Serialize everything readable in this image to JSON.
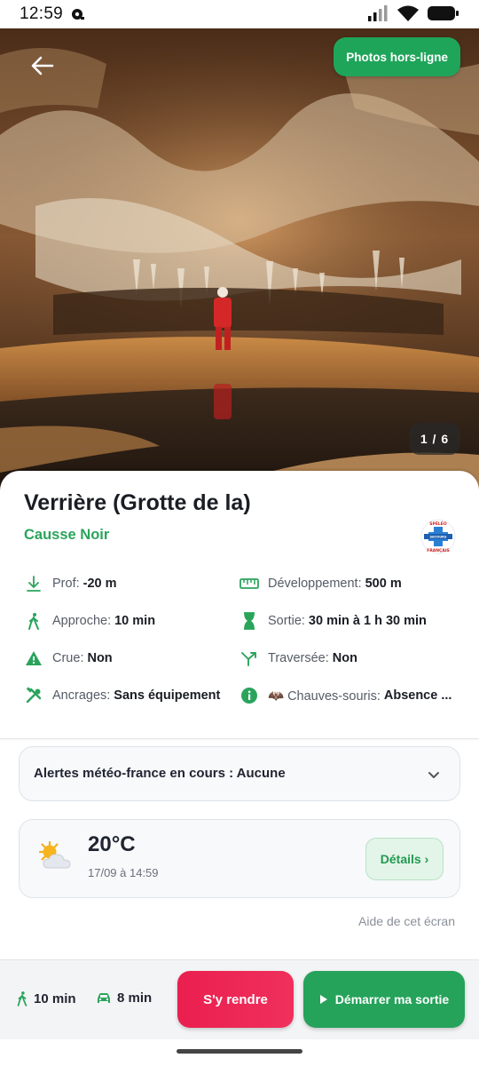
{
  "status_bar": {
    "time": "12:59",
    "icons": [
      "notification-icon",
      "signal-icon",
      "wifi-icon",
      "battery-icon"
    ]
  },
  "hero": {
    "offline_photos_label": "Photos hors-ligne",
    "photo_counter": "1 / 6",
    "icons": [
      "back-arrow-icon"
    ]
  },
  "cave": {
    "title": "Verrière (Grotte de la)",
    "region": "Causse Noir",
    "logo": {
      "name": "speleo-secours-francais-logo",
      "text": [
        "SPÉLÉO",
        "SECOURS",
        "FRANÇAIS"
      ]
    },
    "attributes": [
      {
        "id": "prof",
        "label": "Prof",
        "value": "-20 m",
        "icon": "depth-arrow-icon"
      },
      {
        "id": "developpement",
        "label": "Développement",
        "value": "500 m",
        "icon": "ruler-icon"
      },
      {
        "id": "approche",
        "label": "Approche",
        "value": "10 min",
        "icon": "walking-icon"
      },
      {
        "id": "sortie",
        "label": "Sortie",
        "value": "30 min à 1 h 30 min",
        "icon": "hourglass-icon"
      },
      {
        "id": "crue",
        "label": "Crue",
        "value": "Non",
        "icon": "warning-triangle-icon"
      },
      {
        "id": "traversee",
        "label": "Traversée",
        "value": "Non",
        "icon": "split-arrow-icon"
      },
      {
        "id": "ancrages",
        "label": "Ancrages",
        "value": "Sans équipement",
        "icon": "tools-icon"
      },
      {
        "id": "chauves_souris",
        "label": "🦇 Chauves-souris",
        "value": "Absence ...",
        "icon": "info-icon"
      }
    ]
  },
  "alerts": {
    "text": "Alertes météo-france en cours : Aucune",
    "icon": "chevron-down-icon"
  },
  "weather": {
    "temperature": "20°C",
    "date": "17/09 à 14:59",
    "details_label": "Détails ›",
    "icon": "sun-cloud-icon"
  },
  "help_link": "Aide de cet écran",
  "bottom_bar": {
    "walk_time": "10 min",
    "drive_time": "8 min",
    "go_label": "S'y rendre",
    "start_label": "Démarrer ma sortie",
    "icons": [
      "walking-icon",
      "car-icon",
      "play-icon"
    ]
  },
  "colors": {
    "accent_green": "#25a35a",
    "accent_red": "#ea1f4f",
    "text_dark": "#1a1d24"
  }
}
